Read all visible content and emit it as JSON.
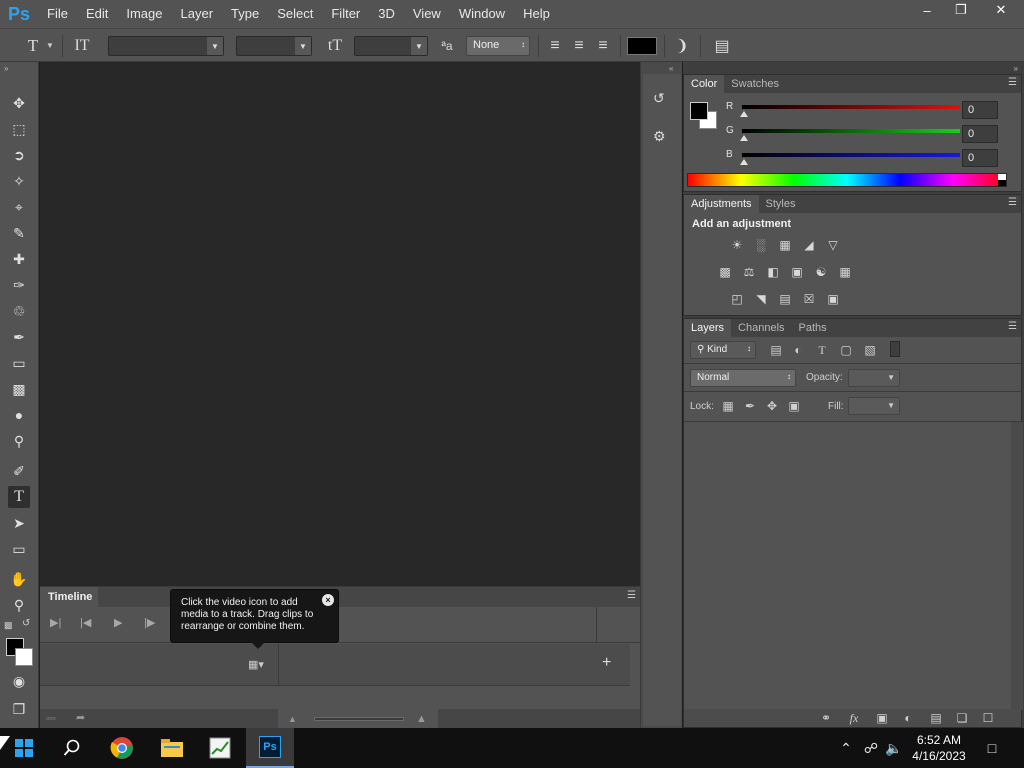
{
  "app": {
    "logo": "Ps",
    "menu": [
      "File",
      "Edit",
      "Image",
      "Layer",
      "Type",
      "Select",
      "Filter",
      "3D",
      "View",
      "Window",
      "Help"
    ]
  },
  "options_bar": {
    "anti_alias": "None"
  },
  "timeline": {
    "tab_label": "Timeline",
    "tooltip": "Click the video icon to add media to a track. Drag clips to rearrange or combine them."
  },
  "color_panel": {
    "tabs": [
      "Color",
      "Swatches"
    ],
    "r_label": "R",
    "g_label": "G",
    "b_label": "B",
    "r_value": "0",
    "g_value": "0",
    "b_value": "0"
  },
  "adjustments_panel": {
    "tabs": [
      "Adjustments",
      "Styles"
    ],
    "heading": "Add an adjustment"
  },
  "layers_panel": {
    "tabs": [
      "Layers",
      "Channels",
      "Paths"
    ],
    "filter_label": "Kind",
    "blend_mode": "Normal",
    "opacity_label": "Opacity:",
    "lock_label": "Lock:",
    "fill_label": "Fill:"
  },
  "taskbar": {
    "time": "6:52 AM",
    "date": "4/16/2023"
  },
  "colors": {
    "accent_ps": "#2da3f0",
    "panel_bg": "#535353",
    "canvas_bg": "#282828"
  }
}
